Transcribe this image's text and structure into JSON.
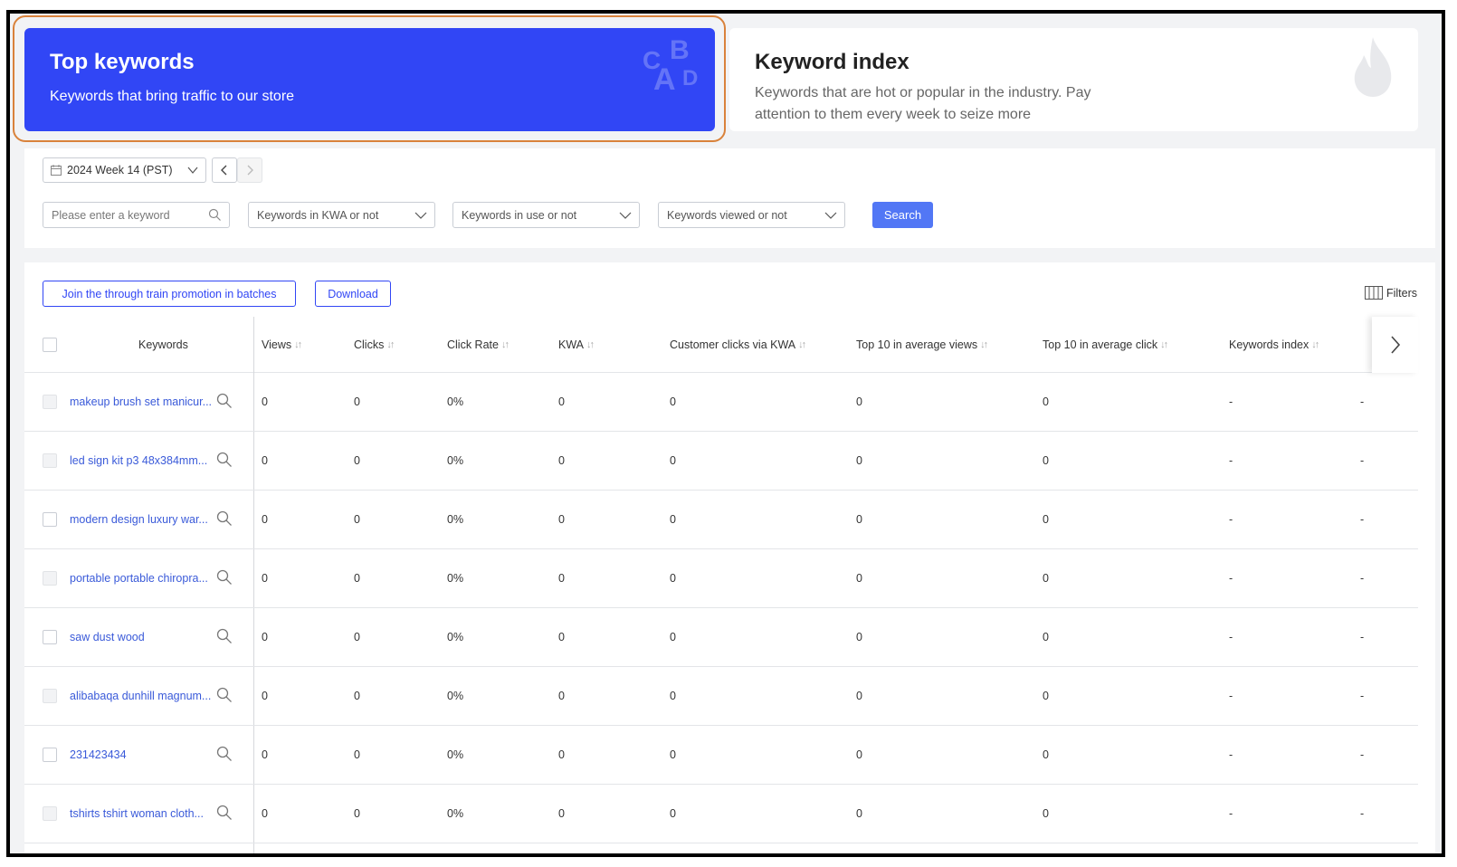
{
  "cards": {
    "top": {
      "title": "Top keywords",
      "subtitle": "Keywords that bring traffic to our store",
      "logo": "CABD",
      "logo_icon": "letters-icon"
    },
    "index": {
      "title": "Keyword index",
      "subtitle": "Keywords that are hot or popular in the industry. Pay attention to them every week to seize more",
      "icon": "flame-icon"
    }
  },
  "filters": {
    "week": "2024 Week 14 (PST)",
    "keyword_placeholder": "Please enter a keyword",
    "kwa": "Keywords in KWA or not",
    "in_use": "Keywords in use or not",
    "viewed": "Keywords viewed or not",
    "search": "Search"
  },
  "toolbar": {
    "join": "Join the through train promotion in batches",
    "download": "Download",
    "filters": "Filters"
  },
  "table": {
    "columns": [
      "Keywords",
      "Views",
      "Clicks",
      "Click Rate",
      "KWA",
      "Customer clicks via KWA",
      "Top 10 in average views",
      "Top 10 in average click",
      "Keywords index"
    ],
    "rows": [
      {
        "keyword": "makeup brush set manicur...",
        "views": "0",
        "clicks": "0",
        "rate": "0%",
        "kwa": "0",
        "cust": "0",
        "top_views": "0",
        "top_click": "0",
        "index": "-",
        "extra": "-",
        "checkbox_disabled": true
      },
      {
        "keyword": "led sign kit p3 48x384mm...",
        "views": "0",
        "clicks": "0",
        "rate": "0%",
        "kwa": "0",
        "cust": "0",
        "top_views": "0",
        "top_click": "0",
        "index": "-",
        "extra": "-",
        "checkbox_disabled": true
      },
      {
        "keyword": "modern design luxury war...",
        "views": "0",
        "clicks": "0",
        "rate": "0%",
        "kwa": "0",
        "cust": "0",
        "top_views": "0",
        "top_click": "0",
        "index": "-",
        "extra": "-",
        "checkbox_disabled": false
      },
      {
        "keyword": "portable portable chiropra...",
        "views": "0",
        "clicks": "0",
        "rate": "0%",
        "kwa": "0",
        "cust": "0",
        "top_views": "0",
        "top_click": "0",
        "index": "-",
        "extra": "-",
        "checkbox_disabled": true
      },
      {
        "keyword": "saw dust wood",
        "views": "0",
        "clicks": "0",
        "rate": "0%",
        "kwa": "0",
        "cust": "0",
        "top_views": "0",
        "top_click": "0",
        "index": "-",
        "extra": "-",
        "checkbox_disabled": false
      },
      {
        "keyword": "alibabaqa dunhill magnum...",
        "views": "0",
        "clicks": "0",
        "rate": "0%",
        "kwa": "0",
        "cust": "0",
        "top_views": "0",
        "top_click": "0",
        "index": "-",
        "extra": "-",
        "checkbox_disabled": true
      },
      {
        "keyword": "231423434",
        "views": "0",
        "clicks": "0",
        "rate": "0%",
        "kwa": "0",
        "cust": "0",
        "top_views": "0",
        "top_click": "0",
        "index": "-",
        "extra": "-",
        "checkbox_disabled": false
      },
      {
        "keyword": "tshirts tshirt woman cloth...",
        "views": "0",
        "clicks": "0",
        "rate": "0%",
        "kwa": "0",
        "cust": "0",
        "top_views": "0",
        "top_click": "0",
        "index": "-",
        "extra": "-",
        "checkbox_disabled": true
      }
    ]
  },
  "colors": {
    "accent": "#3146f5",
    "highlight": "#d9823b",
    "link": "#3a5ad9",
    "search_button": "#5277f5"
  }
}
